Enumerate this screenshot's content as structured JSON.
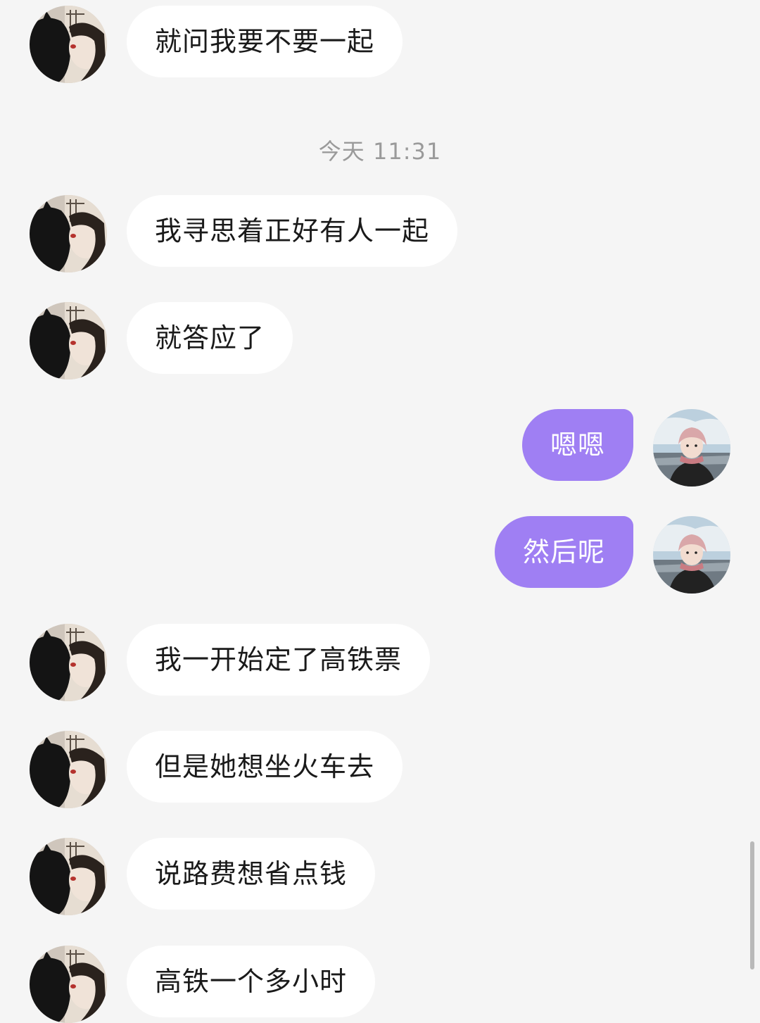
{
  "timestamp": "今天 11:31",
  "contact": {
    "avatar_icon": "contact-avatar-with-cat-icon"
  },
  "self": {
    "avatar_icon": "self-avatar-pink-hat-icon"
  },
  "colors": {
    "background": "#f5f5f5",
    "incoming_bubble": "#ffffff",
    "outgoing_bubble": "#9f7ff3",
    "timestamp_text": "#9a9a9a"
  },
  "messages": [
    {
      "from": "contact",
      "text": "就问我要不要一起"
    },
    {
      "from": "contact",
      "text": "我寻思着正好有人一起"
    },
    {
      "from": "contact",
      "text": "就答应了"
    },
    {
      "from": "self",
      "text": "嗯嗯"
    },
    {
      "from": "self",
      "text": "然后呢"
    },
    {
      "from": "contact",
      "text": "我一开始定了高铁票"
    },
    {
      "from": "contact",
      "text": "但是她想坐火车去"
    },
    {
      "from": "contact",
      "text": "说路费想省点钱"
    },
    {
      "from": "contact",
      "text": "高铁一个多小时"
    }
  ]
}
